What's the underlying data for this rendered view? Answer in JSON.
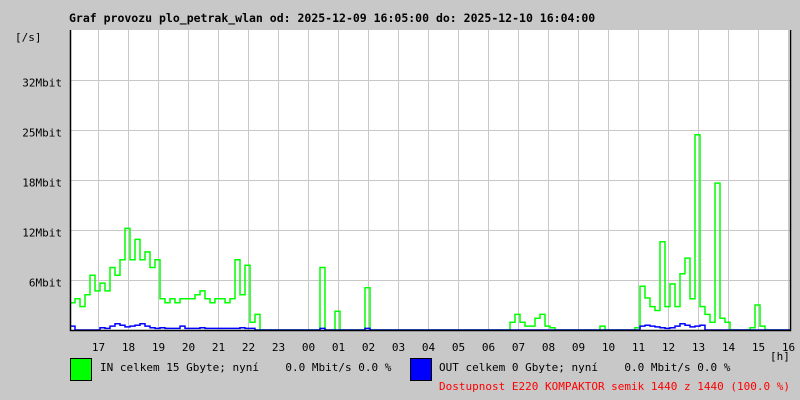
{
  "title": "Graf provozu plo_petrak_wlan od: 2025-12-09 16:05:00 do: 2025-12-10 16:04:00",
  "legend": {
    "in_text": "IN celkem 15 Gbyte; nyní    0.0 Mbit/s 0.0 %",
    "out_text": "OUT celkem 0 Gbyte; nyní    0.0 Mbit/s 0.0 %",
    "availability": "Dostupnost E220 KOMPAKTOR semik 1440 z 1440 (100.0 %)",
    "in_color": "#00ff00",
    "out_color": "#0000ff",
    "availability_color": "#ff0000"
  },
  "chart_data": {
    "type": "line",
    "title": "Graf provozu plo_petrak_wlan od: 2025-12-09 16:05:00 do: 2025-12-10 16:04:00",
    "ylabel": "[/s]",
    "xlabel": "[h]",
    "ylim": [
      0,
      38.4
    ],
    "y_unit": "Mbit",
    "y_ticks": [
      {
        "value": 6.4,
        "label": "6Mbit"
      },
      {
        "value": 12.8,
        "label": "12Mbit"
      },
      {
        "value": 19.2,
        "label": "18Mbit"
      },
      {
        "value": 25.6,
        "label": "25Mbit"
      },
      {
        "value": 32,
        "label": "32Mbit"
      }
    ],
    "x_ticks": [
      "17",
      "18",
      "19",
      "20",
      "21",
      "22",
      "23",
      "00",
      "01",
      "02",
      "03",
      "04",
      "05",
      "06",
      "07",
      "08",
      "09",
      "10",
      "11",
      "12",
      "13",
      "14",
      "15",
      "16"
    ],
    "bucket_minutes": 10,
    "start": "2025-12-09 16:05",
    "grid": true,
    "series": [
      {
        "name": "IN",
        "color": "#00ff00",
        "values": [
          3.5,
          4,
          3,
          4.5,
          7,
          5,
          6,
          5,
          8,
          7,
          9,
          13,
          9,
          11.6,
          9,
          10,
          8,
          9,
          4,
          3.5,
          4,
          3.5,
          4,
          4,
          4,
          4.5,
          5,
          4,
          3.5,
          4,
          4,
          3.5,
          4,
          9,
          4.5,
          8.3,
          1,
          2,
          0,
          0,
          0,
          0,
          0,
          0,
          0,
          0,
          0,
          0,
          0,
          0,
          8,
          0,
          0,
          2.4,
          0,
          0,
          0,
          0,
          0,
          5.4,
          0,
          0,
          0,
          0,
          0,
          0,
          0,
          0,
          0,
          0,
          0,
          0,
          0,
          0,
          0,
          0,
          0,
          0,
          0,
          0,
          0,
          0,
          0,
          0,
          0,
          0,
          0,
          0,
          1,
          2,
          1,
          0.5,
          0.5,
          1.5,
          2,
          0.5,
          0.3,
          0,
          0,
          0,
          0,
          0,
          0,
          0,
          0,
          0,
          0.5,
          0,
          0,
          0,
          0,
          0,
          0,
          0.3,
          5.6,
          4.1,
          3,
          2.5,
          11.3,
          3,
          5.9,
          3,
          7.2,
          9.2,
          4,
          25,
          3,
          2,
          1,
          18.8,
          1.5,
          1,
          0,
          0,
          0,
          0,
          0.3,
          3.2,
          0.5,
          0,
          0,
          0,
          0,
          0
        ]
      },
      {
        "name": "OUT",
        "color": "#0000ff",
        "values": [
          0.5,
          0,
          0,
          0,
          0,
          0,
          0.3,
          0.2,
          0.5,
          0.8,
          0.6,
          0.4,
          0.5,
          0.6,
          0.8,
          0.5,
          0.3,
          0.2,
          0.3,
          0.2,
          0.2,
          0.2,
          0.5,
          0.2,
          0.2,
          0.2,
          0.3,
          0.2,
          0.2,
          0.2,
          0.2,
          0.2,
          0.2,
          0.2,
          0.3,
          0.2,
          0.2,
          0,
          0,
          0,
          0,
          0,
          0,
          0,
          0,
          0,
          0,
          0,
          0,
          0,
          0.2,
          0,
          0,
          0,
          0,
          0,
          0,
          0,
          0,
          0.2,
          0,
          0,
          0,
          0,
          0,
          0,
          0,
          0,
          0,
          0,
          0,
          0,
          0,
          0,
          0,
          0,
          0,
          0,
          0,
          0,
          0,
          0,
          0,
          0,
          0,
          0,
          0,
          0,
          0,
          0,
          0,
          0,
          0,
          0,
          0,
          0,
          0,
          0,
          0,
          0,
          0,
          0,
          0,
          0,
          0,
          0,
          0,
          0,
          0,
          0,
          0,
          0,
          0,
          0,
          0.5,
          0.6,
          0.5,
          0.4,
          0.3,
          0.2,
          0.3,
          0.5,
          0.8,
          0.6,
          0.4,
          0.5,
          0.6,
          0,
          0,
          0,
          0,
          0,
          0,
          0,
          0,
          0,
          0,
          0,
          0,
          0,
          0,
          0,
          0,
          0
        ]
      }
    ]
  }
}
